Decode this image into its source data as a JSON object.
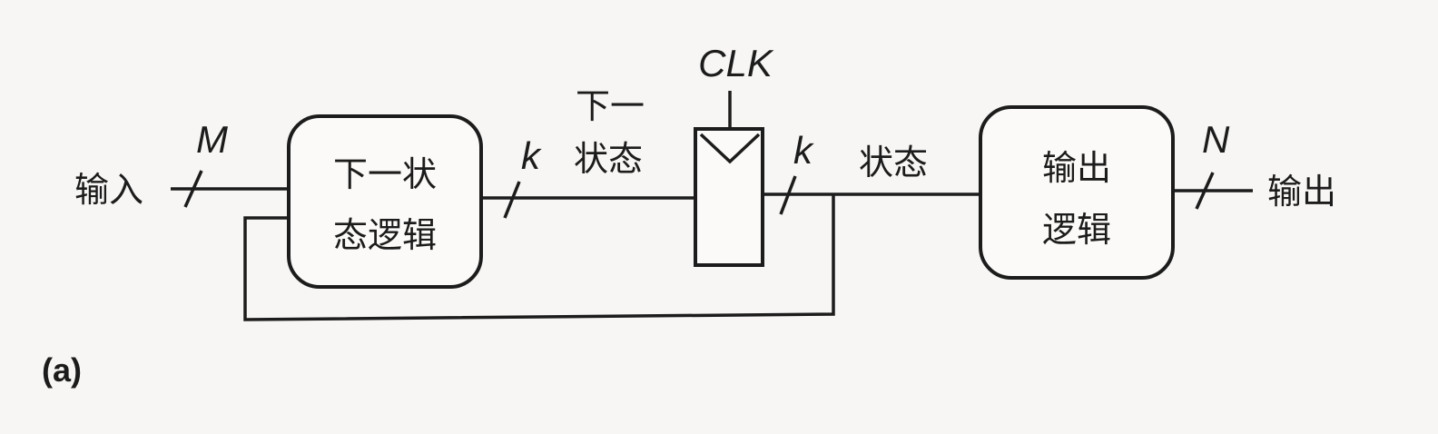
{
  "input_label": "输入",
  "output_label": "输出",
  "input_width": "M",
  "output_width": "N",
  "next_state_bus_width": "k",
  "state_bus_width": "k",
  "next_state_label_line1": "下一",
  "next_state_label_line2": "状态",
  "state_label": "状态",
  "clock_label": "CLK",
  "next_state_logic": {
    "line1": "下一状",
    "line2": "态逻辑"
  },
  "output_logic": {
    "line1": "输出",
    "line2": "逻辑"
  },
  "panel_label": "(a)"
}
